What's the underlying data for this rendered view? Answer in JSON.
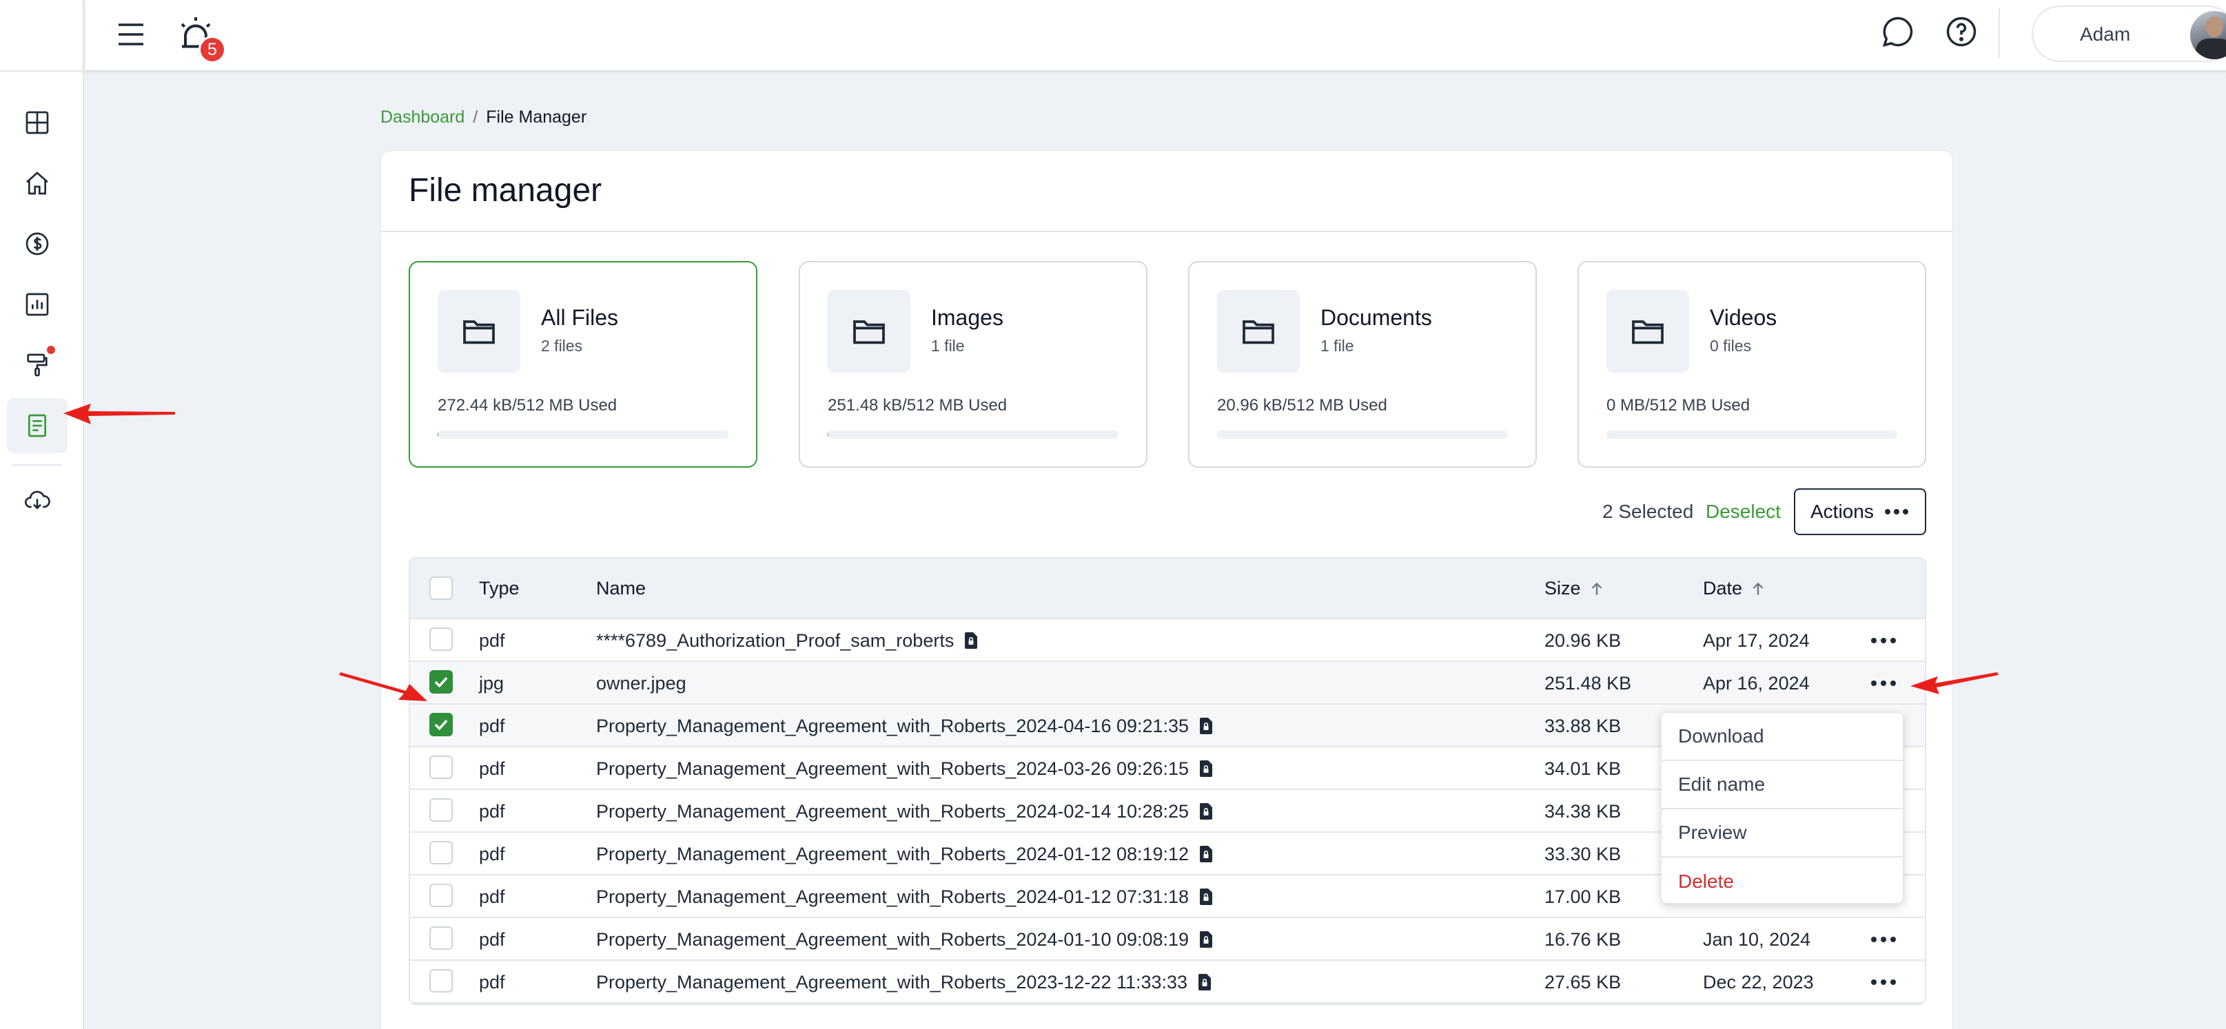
{
  "topbar": {
    "notification_count": "5",
    "user_name": "Adam"
  },
  "breadcrumb": {
    "parent": "Dashboard",
    "separator": "/",
    "current": "File Manager"
  },
  "page": {
    "title": "File manager"
  },
  "storage_cards": [
    {
      "title": "All Files",
      "count": "2 files",
      "used": "272.44 kB/512 MB Used",
      "fraction": 0.0005
    },
    {
      "title": "Images",
      "count": "1 file",
      "used": "251.48 kB/512 MB Used",
      "fraction": 0.0005
    },
    {
      "title": "Documents",
      "count": "1 file",
      "used": "20.96 kB/512 MB Used",
      "fraction": 4e-05
    },
    {
      "title": "Videos",
      "count": "0 files",
      "used": "0 MB/512 MB Used",
      "fraction": 0
    }
  ],
  "selection": {
    "count_label": "2 Selected",
    "deselect_label": "Deselect",
    "actions_label": "Actions"
  },
  "table": {
    "headers": {
      "type": "Type",
      "name": "Name",
      "size": "Size",
      "date": "Date"
    },
    "rows": [
      {
        "type": "pdf",
        "name": "****6789_Authorization_Proof_sam_roberts",
        "locked": true,
        "size": "20.96 KB",
        "date": "Apr 17, 2024",
        "checked": false
      },
      {
        "type": "jpg",
        "name": "owner.jpeg",
        "locked": false,
        "size": "251.48 KB",
        "date": "Apr 16, 2024",
        "checked": true
      },
      {
        "type": "pdf",
        "name": "Property_Management_Agreement_with_Roberts_2024-04-16 09:21:35",
        "locked": true,
        "size": "33.88 KB",
        "date": "",
        "checked": true
      },
      {
        "type": "pdf",
        "name": "Property_Management_Agreement_with_Roberts_2024-03-26 09:26:15",
        "locked": true,
        "size": "34.01 KB",
        "date": "",
        "checked": false
      },
      {
        "type": "pdf",
        "name": "Property_Management_Agreement_with_Roberts_2024-02-14 10:28:25",
        "locked": true,
        "size": "34.38 KB",
        "date": "",
        "checked": false
      },
      {
        "type": "pdf",
        "name": "Property_Management_Agreement_with_Roberts_2024-01-12 08:19:12",
        "locked": true,
        "size": "33.30 KB",
        "date": "",
        "checked": false
      },
      {
        "type": "pdf",
        "name": "Property_Management_Agreement_with_Roberts_2024-01-12 07:31:18",
        "locked": true,
        "size": "17.00 KB",
        "date": "",
        "checked": false
      },
      {
        "type": "pdf",
        "name": "Property_Management_Agreement_with_Roberts_2024-01-10 09:08:19",
        "locked": true,
        "size": "16.76 KB",
        "date": "Jan 10, 2024",
        "checked": false
      },
      {
        "type": "pdf",
        "name": "Property_Management_Agreement_with_Roberts_2023-12-22 11:33:33",
        "locked": true,
        "size": "27.65 KB",
        "date": "Dec 22, 2023",
        "checked": false
      }
    ]
  },
  "context_menu": {
    "items": [
      "Download",
      "Edit name",
      "Preview",
      "Delete"
    ]
  },
  "colors": {
    "accent": "#3a9a3a",
    "danger": "#d32f2f",
    "annotation_arrow": "#e8201c"
  },
  "icons": {
    "sidebar": [
      "dashboard-icon",
      "home-icon",
      "dollar-icon",
      "chart-icon",
      "paint-roller-icon",
      "document-icon",
      "cloud-download-icon"
    ],
    "topbar": [
      "menu-icon",
      "alarm-bell-icon",
      "chat-icon",
      "help-icon"
    ]
  }
}
